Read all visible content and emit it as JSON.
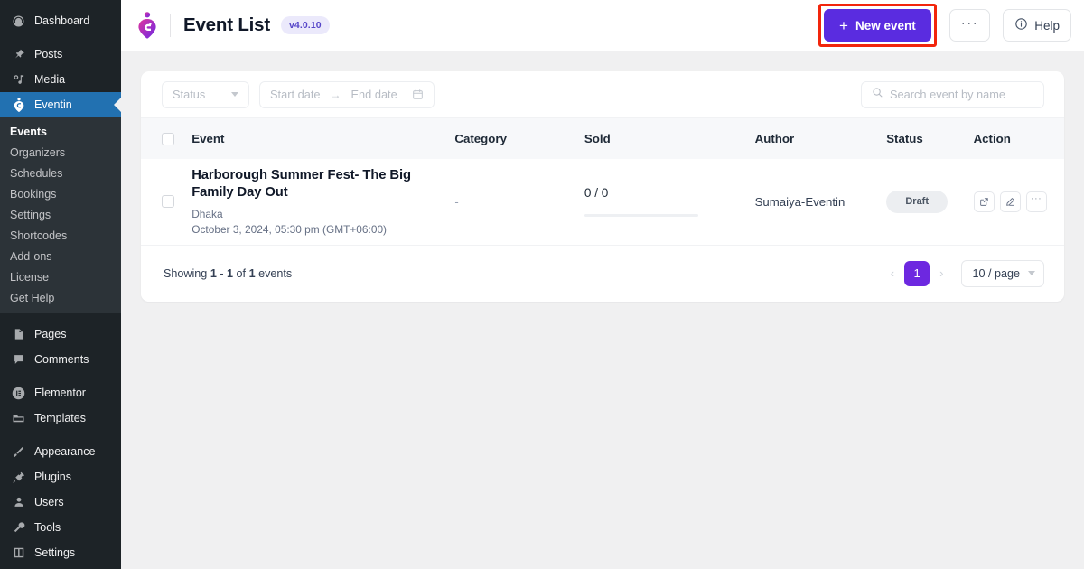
{
  "sidebar": {
    "items": [
      {
        "label": "Dashboard",
        "icon": "dashboard-icon",
        "active": false
      },
      {
        "label": "Posts",
        "icon": "pin-icon",
        "active": false
      },
      {
        "label": "Media",
        "icon": "media-icon",
        "active": false
      },
      {
        "label": "Eventin",
        "icon": "eventin-icon",
        "active": true
      },
      {
        "label": "Pages",
        "icon": "pages-icon",
        "active": false
      },
      {
        "label": "Comments",
        "icon": "comments-icon",
        "active": false
      },
      {
        "label": "Elementor",
        "icon": "elementor-icon",
        "active": false
      },
      {
        "label": "Templates",
        "icon": "templates-icon",
        "active": false
      },
      {
        "label": "Appearance",
        "icon": "appearance-icon",
        "active": false
      },
      {
        "label": "Plugins",
        "icon": "plugins-icon",
        "active": false
      },
      {
        "label": "Users",
        "icon": "users-icon",
        "active": false
      },
      {
        "label": "Tools",
        "icon": "tools-icon",
        "active": false
      },
      {
        "label": "Settings",
        "icon": "settings-icon",
        "active": false
      }
    ],
    "submenu": [
      {
        "label": "Events",
        "current": true
      },
      {
        "label": "Organizers",
        "current": false
      },
      {
        "label": "Schedules",
        "current": false
      },
      {
        "label": "Bookings",
        "current": false
      },
      {
        "label": "Settings",
        "current": false
      },
      {
        "label": "Shortcodes",
        "current": false
      },
      {
        "label": "Add-ons",
        "current": false
      },
      {
        "label": "License",
        "current": false
      },
      {
        "label": "Get Help",
        "current": false
      }
    ]
  },
  "header": {
    "logo_icon": "eventin-logo-icon",
    "title": "Event List",
    "version": "v4.0.10",
    "new_event_label": "New event",
    "more_label": "···",
    "help_label": "Help",
    "primary_color": "#5a2ce0",
    "annotation_color": "#f2250c"
  },
  "filters": {
    "status_label": "Status",
    "start_date_placeholder": "Start date",
    "range_arrow": "→",
    "end_date_placeholder": "End date",
    "search_placeholder": "Search event by name",
    "search_value": ""
  },
  "table": {
    "columns": [
      "Event",
      "Category",
      "Sold",
      "Author",
      "Status",
      "Action"
    ],
    "rows": [
      {
        "event_title": "Harborough Summer Fest- The Big Family Day Out",
        "event_location": "Dhaka",
        "event_datetime": "October 3, 2024, 05:30 pm (GMT+06:00)",
        "category": "-",
        "sold": "0 / 0",
        "sold_percent": 0,
        "author": "Sumaiya-Eventin",
        "status": "Draft",
        "actions": [
          "external-link-icon",
          "edit-icon",
          "more-icon"
        ]
      }
    ]
  },
  "footer": {
    "showing_prefix": "Showing ",
    "showing_from": "1",
    "showing_dash": " - ",
    "showing_to": "1",
    "showing_mid": " of ",
    "showing_total": "1",
    "showing_suffix": " events",
    "prev_label": "‹",
    "current_page": "1",
    "next_label": "›",
    "per_page_label": "10 / page",
    "accent_color": "#6d28e0"
  }
}
